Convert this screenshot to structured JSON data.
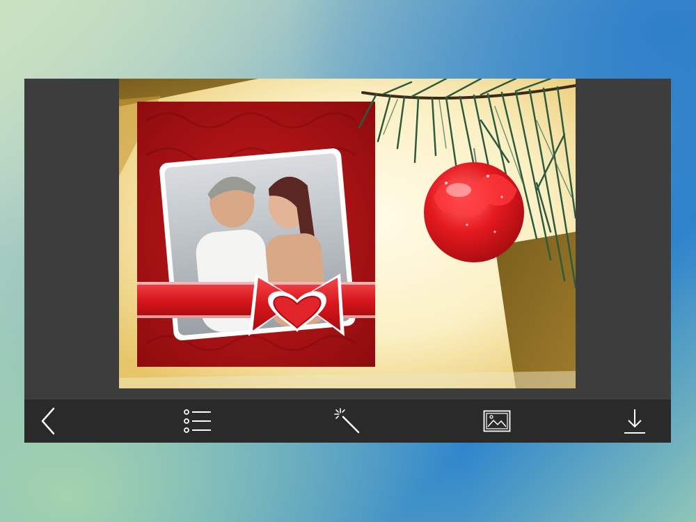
{
  "toolbar": {
    "items": [
      {
        "name": "back-button",
        "icon": "chevron-left-icon"
      },
      {
        "name": "list-button",
        "icon": "list-icon"
      },
      {
        "name": "effects-button",
        "icon": "magic-wand-icon"
      },
      {
        "name": "gallery-button",
        "icon": "image-icon"
      },
      {
        "name": "download-button",
        "icon": "download-icon"
      }
    ]
  },
  "frame": {
    "theme": "christmas-red-bow-frame",
    "colors": {
      "frame_red": "#b41416",
      "ribbon_red": "#e0242a",
      "gold": "#8a6a22",
      "cream": "#f6eecd",
      "ornament_red": "#e5191e",
      "pine_green": "#2d5a3c",
      "toolbar_bg": "#2a2a2a",
      "device_bg": "#3d3d3d"
    }
  }
}
